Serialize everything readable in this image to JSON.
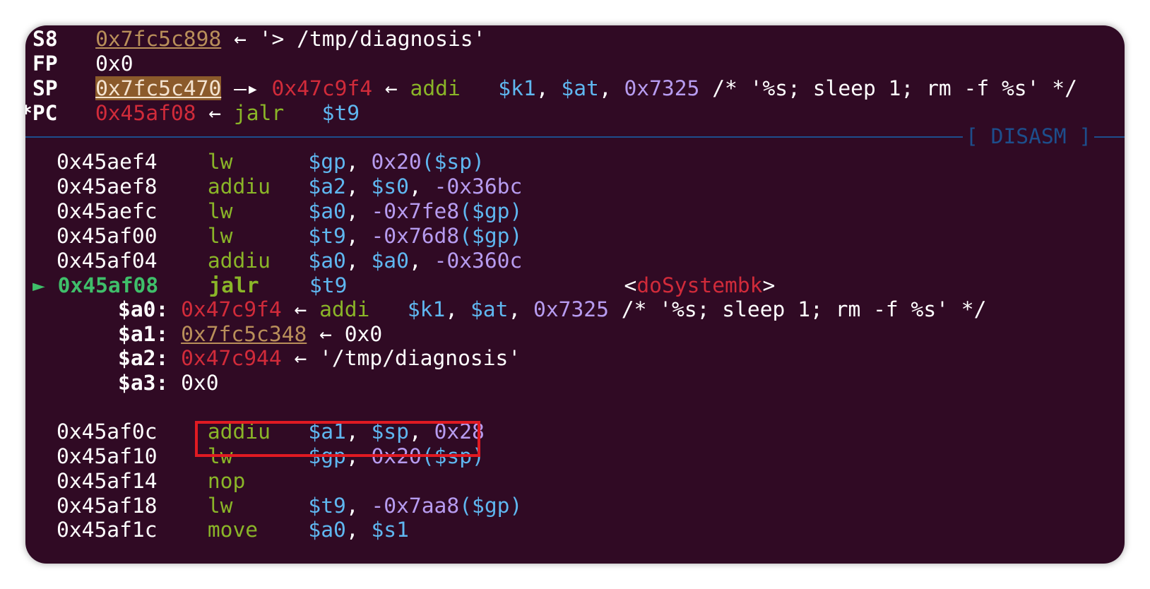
{
  "registers": {
    "s8": {
      "name": "S8",
      "addr": "0x7fc5c898",
      "arrow": " ← ",
      "value": "'> /tmp/diagnosis'"
    },
    "fp": {
      "name": "FP",
      "value": "0x0"
    },
    "sp": {
      "name": "SP",
      "addr": "0x7fc5c470",
      "arrow1": " —▸ ",
      "ptr": "0x47c9f4",
      "arrow2": " ← ",
      "mnem": "addi",
      "op1": "$k1",
      "op2": "$at",
      "imm": "0x7325",
      "comment": " /* '%s; sleep 1; rm -f %s' */"
    },
    "pc": {
      "mark": "*",
      "name": "PC",
      "addr": "0x45af08",
      "arrow": " ← ",
      "mnem": "jalr",
      "op": "$t9"
    }
  },
  "section_label": "[ DISASM ]",
  "disasm": [
    {
      "addr": "0x45aef4",
      "mnem": "lw",
      "a": "$gp",
      "b": "0x20",
      "c": "($sp)"
    },
    {
      "addr": "0x45aef8",
      "mnem": "addiu",
      "a": "$a2",
      "b": "$s0",
      "c": "-0x36bc"
    },
    {
      "addr": "0x45aefc",
      "mnem": "lw",
      "a": "$a0",
      "b": "-0x7fe8",
      "c": "($gp)"
    },
    {
      "addr": "0x45af00",
      "mnem": "lw",
      "a": "$t9",
      "b": "-0x76d8",
      "c": "($gp)"
    },
    {
      "addr": "0x45af04",
      "mnem": "addiu",
      "a": "$a0",
      "b": "$a0",
      "c": "-0x360c"
    }
  ],
  "current": {
    "marker": "►",
    "addr": "0x45af08",
    "mnem": "jalr",
    "op": "$t9",
    "target_open": "<",
    "target": "doSystembk",
    "target_close": ">"
  },
  "args": {
    "a0": {
      "name": "$a0:",
      "addr": "0x47c9f4",
      "arrow": " ← ",
      "mnem": "addi",
      "op1": "$k1",
      "op2": "$at",
      "imm": "0x7325",
      "comment": " /* '%s; sleep 1; rm -f %s' */"
    },
    "a1": {
      "name": "$a1:",
      "addr": "0x7fc5c348",
      "arrow": " ← ",
      "value": "0x0"
    },
    "a2": {
      "name": "$a2:",
      "addr": "0x47c944",
      "arrow": " ← ",
      "value": "'/tmp/diagnosis'"
    },
    "a3": {
      "name": "$a3:",
      "value": "0x0"
    }
  },
  "after": [
    {
      "addr": "0x45af0c",
      "mnem": "addiu",
      "a": "$a1",
      "b": "$sp",
      "c": "0x28"
    },
    {
      "addr": "0x45af10",
      "mnem": "lw",
      "a": "$gp",
      "b": "0x20",
      "c": "($sp)"
    },
    {
      "addr": "0x45af14",
      "mnem": "nop"
    },
    {
      "addr": "0x45af18",
      "mnem": "lw",
      "a": "$t9",
      "b": "-0x7aa8",
      "c": "($gp)"
    },
    {
      "addr": "0x45af1c",
      "mnem": "move",
      "a": "$a0",
      "b": "$s1"
    }
  ],
  "colors": {
    "background": "#300a24",
    "highlight_box": "#e01a22",
    "separator": "#1d4e8c"
  }
}
